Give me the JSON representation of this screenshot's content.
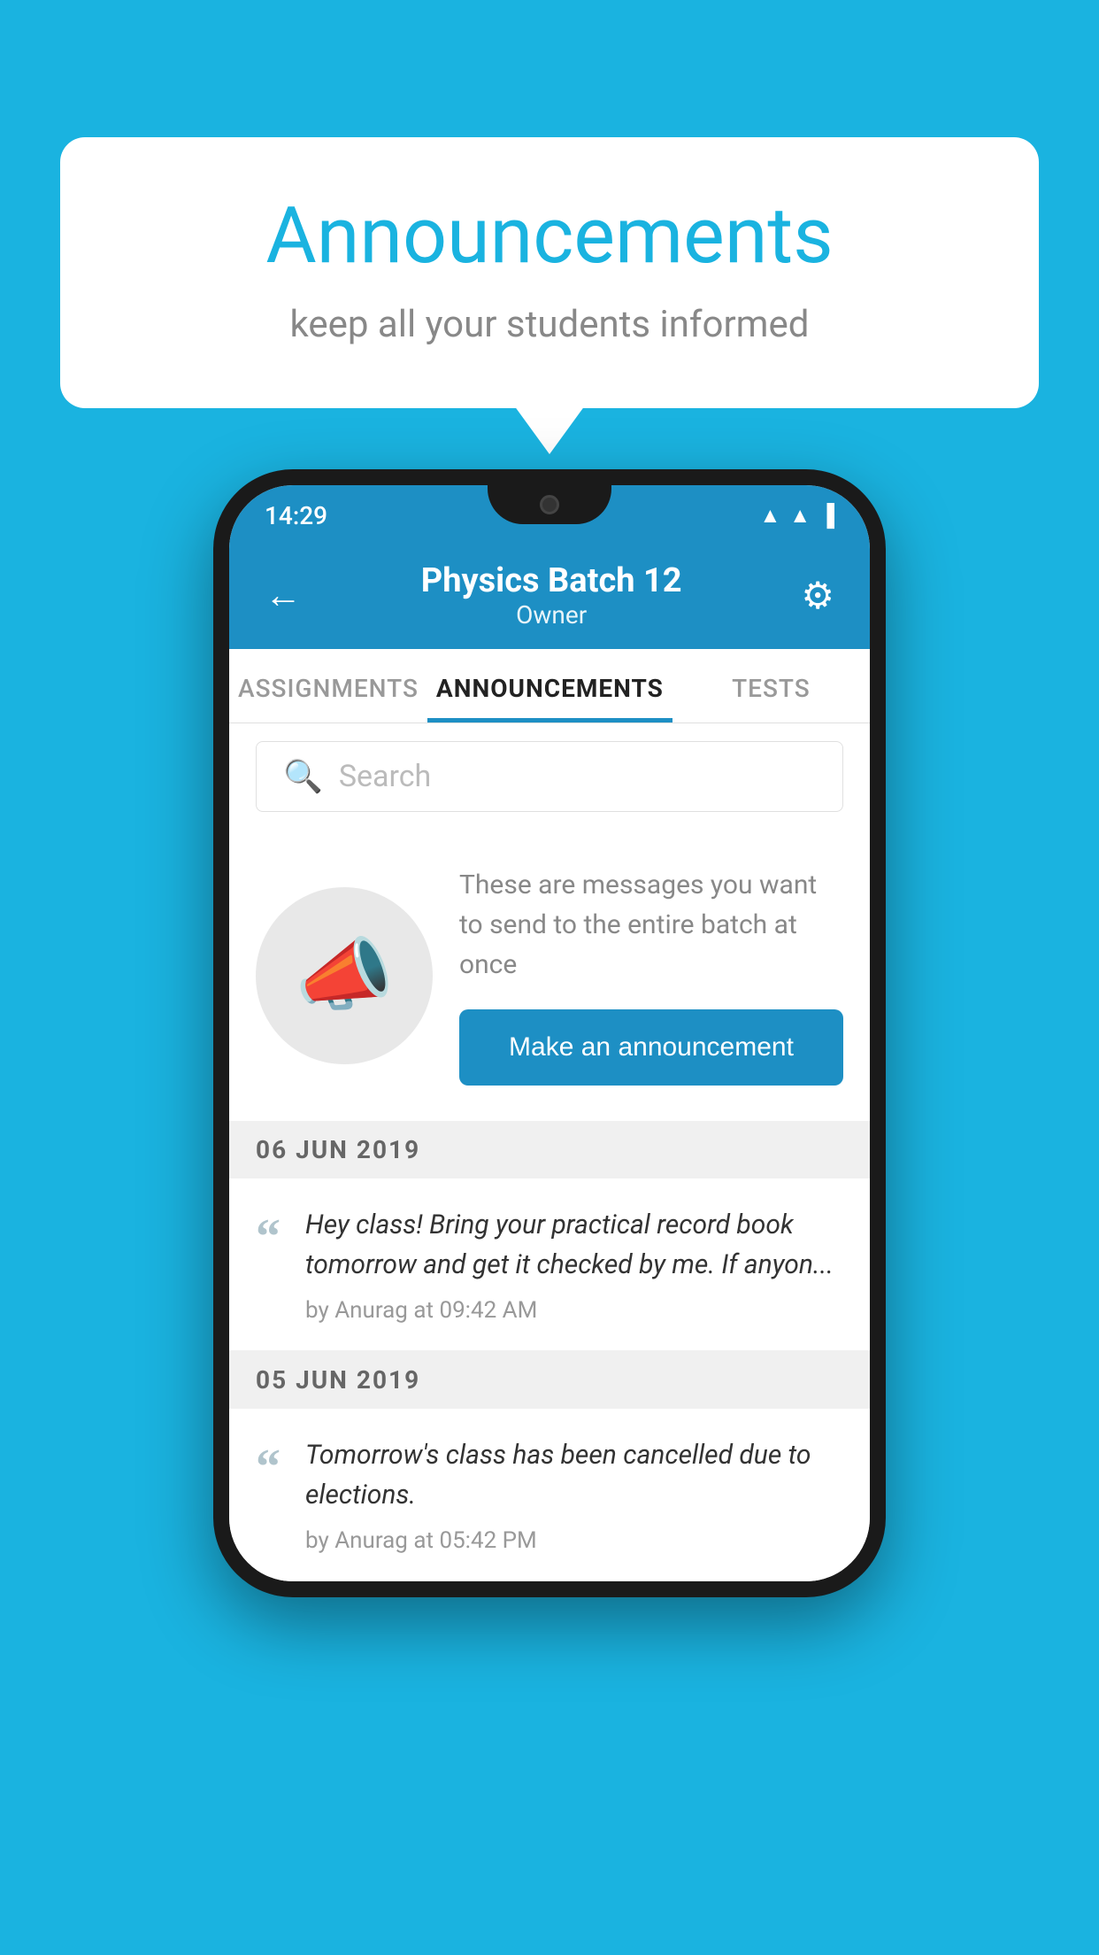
{
  "background_color": "#1ab3e0",
  "speech_bubble": {
    "title": "Announcements",
    "subtitle": "keep all your students informed"
  },
  "phone": {
    "status_bar": {
      "time": "14:29"
    },
    "header": {
      "back_label": "←",
      "title": "Physics Batch 12",
      "subtitle": "Owner",
      "gear_label": "⚙"
    },
    "tabs": [
      {
        "label": "ASSIGNMENTS",
        "active": false
      },
      {
        "label": "ANNOUNCEMENTS",
        "active": true
      },
      {
        "label": "TESTS",
        "active": false
      }
    ],
    "search": {
      "placeholder": "Search"
    },
    "empty_state": {
      "description": "These are messages you want to send to the entire batch at once",
      "button_label": "Make an announcement"
    },
    "announcements": [
      {
        "date": "06  JUN  2019",
        "items": [
          {
            "text": "Hey class! Bring your practical record book tomorrow and get it checked by me. If anyon...",
            "meta": "by Anurag at 09:42 AM"
          }
        ]
      },
      {
        "date": "05  JUN  2019",
        "items": [
          {
            "text": "Tomorrow's class has been cancelled due to elections.",
            "meta": "by Anurag at 05:42 PM"
          }
        ]
      }
    ]
  }
}
